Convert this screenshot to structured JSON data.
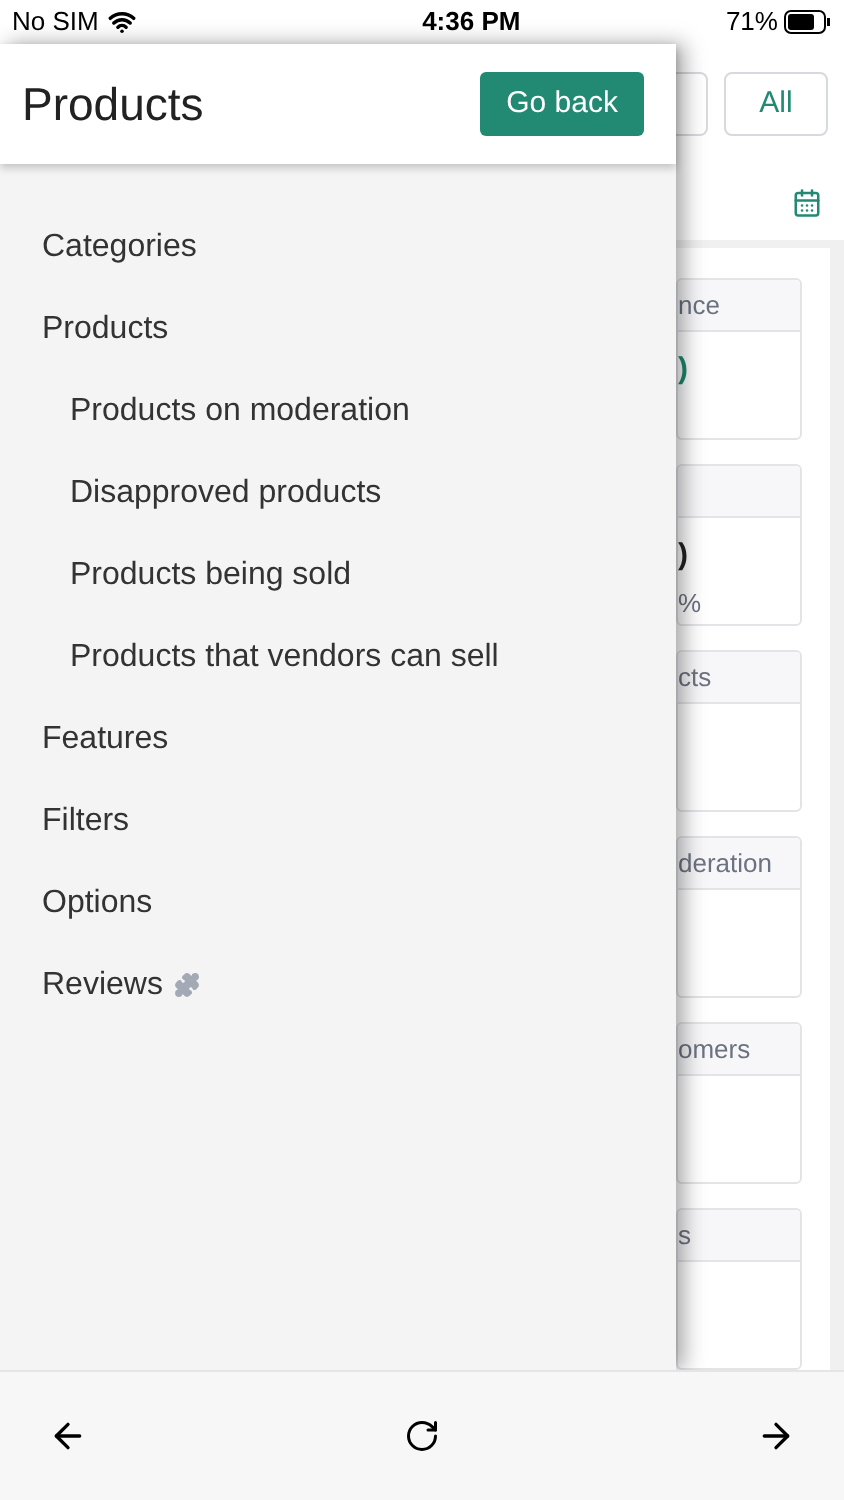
{
  "status_bar": {
    "carrier": "No SIM",
    "time": "4:36 PM",
    "battery": "71%"
  },
  "drawer": {
    "title": "Products",
    "back_button": "Go back",
    "items": [
      {
        "label": "Categories"
      },
      {
        "label": "Products",
        "children": [
          {
            "label": "Products on moderation"
          },
          {
            "label": "Disapproved products"
          },
          {
            "label": "Products being sold"
          },
          {
            "label": "Products that vendors can sell"
          }
        ]
      },
      {
        "label": "Features"
      },
      {
        "label": "Filters"
      },
      {
        "label": "Options"
      },
      {
        "label": "Reviews",
        "addon": true
      }
    ]
  },
  "background": {
    "filter_button": "All",
    "cards": [
      {
        "header": "nce",
        "value": ")",
        "kind": "accent"
      },
      {
        "value": ")",
        "kind": "plain",
        "note": "%"
      },
      {
        "header": "cts"
      },
      {
        "header": "deration"
      },
      {
        "header": "omers"
      },
      {
        "header": "s"
      }
    ]
  }
}
